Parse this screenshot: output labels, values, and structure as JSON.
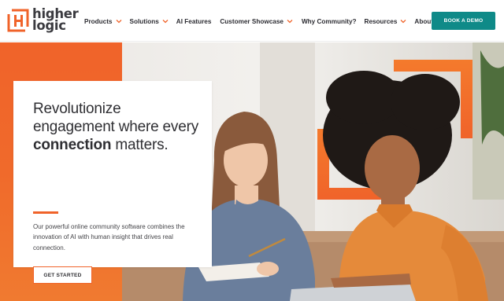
{
  "brand": {
    "logo_line1": "higher",
    "logo_line2": "logic",
    "logo_icon": "higher-logic-h-mark",
    "accent": "#f0632a",
    "teal": "#0f8a88"
  },
  "nav": {
    "items": [
      {
        "label": "Products",
        "has_dropdown": true
      },
      {
        "label": "Solutions",
        "has_dropdown": true
      },
      {
        "label": "AI Features",
        "has_dropdown": false
      },
      {
        "label": "Customer Showcase",
        "has_dropdown": true
      },
      {
        "label": "Why Community?",
        "has_dropdown": false
      },
      {
        "label": "Resources",
        "has_dropdown": true
      },
      {
        "label": "About",
        "has_dropdown": true
      }
    ],
    "cta_label": "BOOK A DEMO"
  },
  "hero": {
    "headline_part1": "Revolutionize engagement where every ",
    "headline_bold": "connection",
    "headline_part2": " matters.",
    "body": "Our powerful online community software combines the innovation of AI with human insight that drives real connection.",
    "cta_label": "GET STARTED",
    "image_alt": "Two smiling women working together on a laptop"
  }
}
